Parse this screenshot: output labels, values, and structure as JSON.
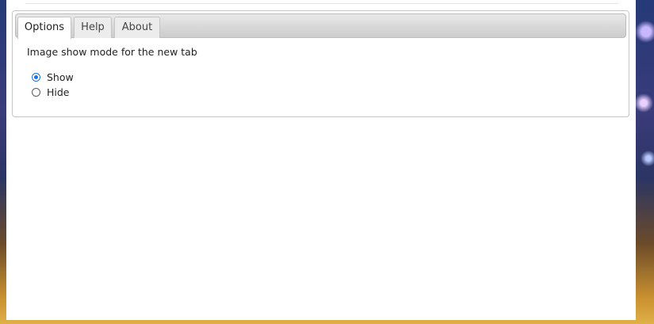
{
  "tabs": [
    {
      "label": "Options",
      "active": true
    },
    {
      "label": "Help",
      "active": false
    },
    {
      "label": "About",
      "active": false
    }
  ],
  "options_panel": {
    "title": "Image show mode for the new tab",
    "radios": [
      {
        "label": "Show",
        "checked": true
      },
      {
        "label": "Hide",
        "checked": false
      }
    ]
  },
  "colors": {
    "accent": "#1a73e8",
    "tab_bar": "#d8d8d8",
    "border": "#c5c5c5"
  }
}
